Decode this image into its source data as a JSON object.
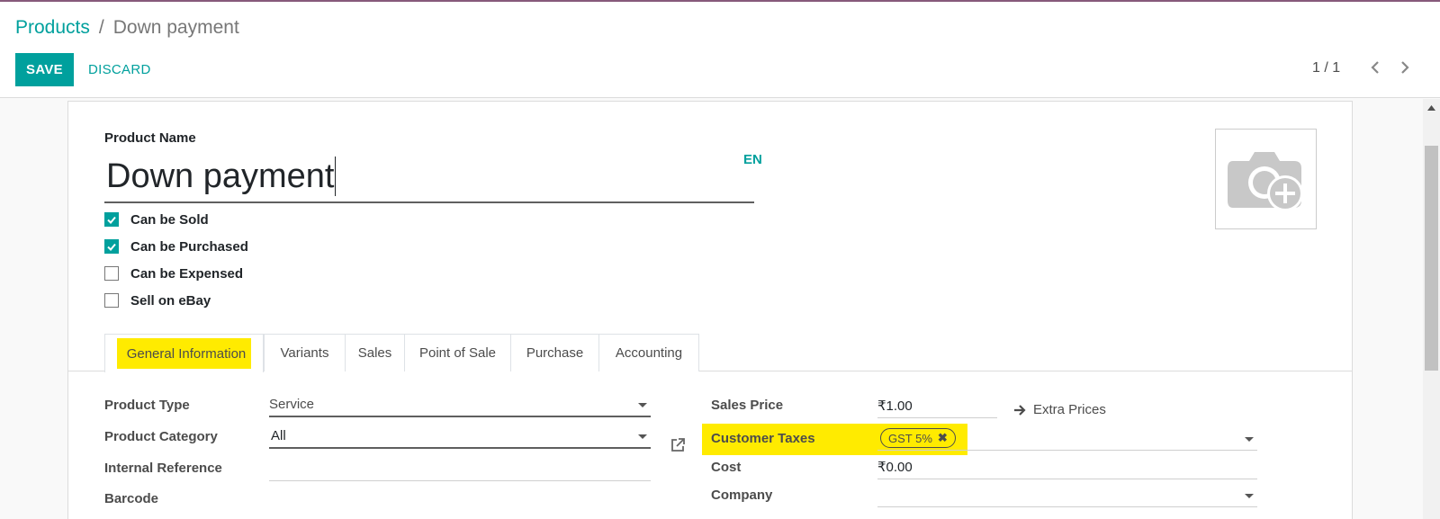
{
  "breadcrumb": {
    "parent": "Products",
    "separator": "/",
    "current": "Down payment"
  },
  "toolbar": {
    "save_label": "SAVE",
    "discard_label": "DISCARD"
  },
  "pager": {
    "value": "1 / 1"
  },
  "product": {
    "name_label": "Product Name",
    "name_value": "Down payment",
    "lang": "EN",
    "checkboxes": [
      {
        "label": "Can be Sold",
        "checked": true
      },
      {
        "label": "Can be Purchased",
        "checked": true
      },
      {
        "label": "Can be Expensed",
        "checked": false
      },
      {
        "label": "Sell on eBay",
        "checked": false
      }
    ]
  },
  "tabs": [
    {
      "label": "General Information",
      "active": true
    },
    {
      "label": "Variants"
    },
    {
      "label": "Sales"
    },
    {
      "label": "Point of Sale"
    },
    {
      "label": "Purchase"
    },
    {
      "label": "Accounting"
    }
  ],
  "left_fields": {
    "product_type": {
      "label": "Product Type",
      "value": "Service"
    },
    "product_category": {
      "label": "Product Category",
      "value": "All"
    },
    "internal_reference": {
      "label": "Internal Reference",
      "value": ""
    },
    "barcode": {
      "label": "Barcode",
      "value": ""
    }
  },
  "right_fields": {
    "sales_price": {
      "label": "Sales Price",
      "value": "₹1.00"
    },
    "extra_prices": "Extra Prices",
    "customer_taxes": {
      "label": "Customer Taxes",
      "tag": "GST 5%"
    },
    "cost": {
      "label": "Cost",
      "value": "₹0.00"
    },
    "company": {
      "label": "Company",
      "value": ""
    }
  },
  "colors": {
    "accent": "#00a09d",
    "highlight": "#ffeb00",
    "top_bar": "#875a7b"
  }
}
